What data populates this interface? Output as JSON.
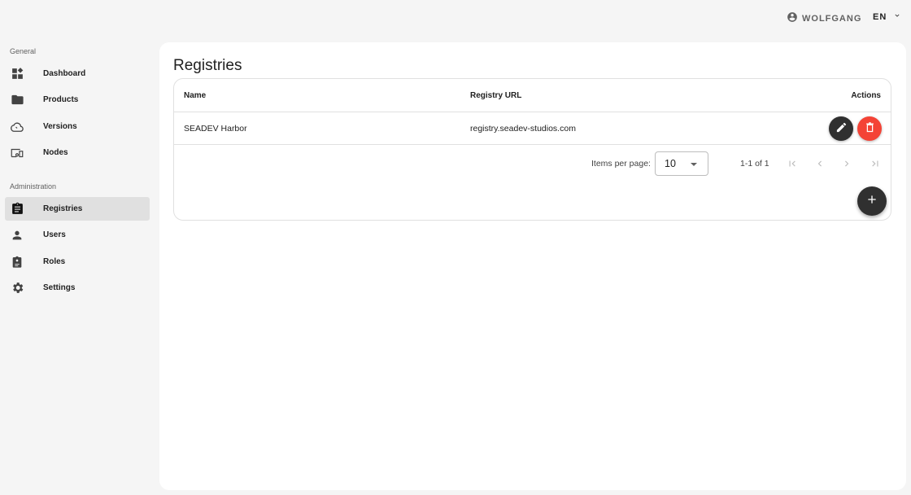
{
  "header": {
    "user_name": "WOLFGANG",
    "language": "EN"
  },
  "sidebar": {
    "sections": [
      {
        "label": "General",
        "items": [
          {
            "label": "Dashboard",
            "icon": "dashboard-icon"
          },
          {
            "label": "Products",
            "icon": "folder-icon"
          },
          {
            "label": "Versions",
            "icon": "cloud-icon"
          },
          {
            "label": "Nodes",
            "icon": "devices-icon"
          }
        ]
      },
      {
        "label": "Administration",
        "items": [
          {
            "label": "Registries",
            "icon": "clipboard-icon",
            "active": true
          },
          {
            "label": "Users",
            "icon": "person-icon"
          },
          {
            "label": "Roles",
            "icon": "badge-icon"
          },
          {
            "label": "Settings",
            "icon": "gear-icon"
          }
        ]
      }
    ]
  },
  "main": {
    "title": "Registries",
    "table": {
      "columns": [
        "Name",
        "Registry URL",
        "Actions"
      ],
      "rows": [
        {
          "name": "SEADEV Harbor",
          "url": "registry.seadev-studios.com"
        }
      ]
    },
    "paginator": {
      "items_per_page_label": "Items per page:",
      "items_per_page": "10",
      "range_label": "1-1 of 1"
    }
  },
  "colors": {
    "delete": "#f44336",
    "dark_button": "#303030",
    "background": "#f5f5f5"
  }
}
